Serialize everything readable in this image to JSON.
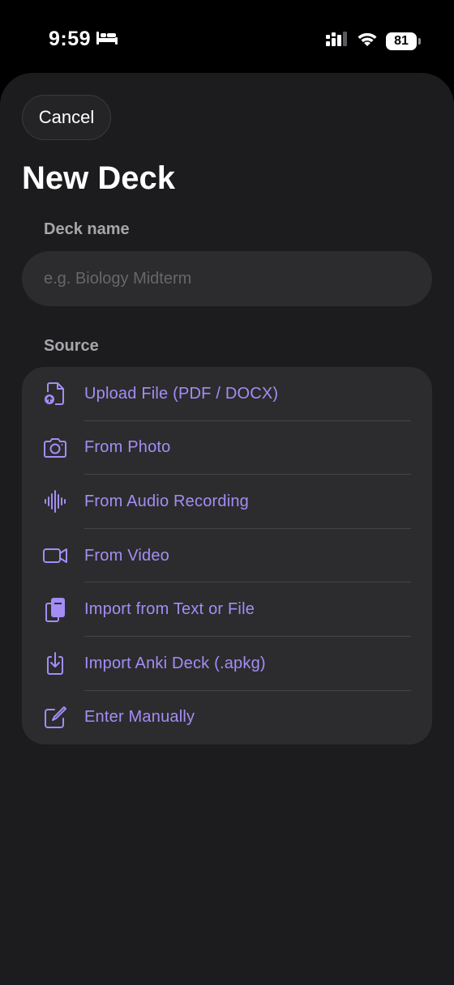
{
  "status_bar": {
    "time": "9:59",
    "battery": "81"
  },
  "sheet": {
    "cancel_label": "Cancel",
    "title": "New Deck"
  },
  "deck_name": {
    "label": "Deck name",
    "placeholder": "e.g. Biology Midterm",
    "value": ""
  },
  "source": {
    "label": "Source",
    "items": [
      {
        "label": "Upload File (PDF / DOCX)",
        "icon": "upload-file-icon"
      },
      {
        "label": "From Photo",
        "icon": "camera-icon"
      },
      {
        "label": "From Audio Recording",
        "icon": "waveform-icon"
      },
      {
        "label": "From Video",
        "icon": "video-camera-icon"
      },
      {
        "label": "Import from Text or File",
        "icon": "documents-icon"
      },
      {
        "label": "Import Anki Deck (.apkg)",
        "icon": "download-tray-icon"
      },
      {
        "label": "Enter Manually",
        "icon": "compose-icon"
      }
    ]
  },
  "colors": {
    "accent": "#a48df5",
    "sheet_background": "#1c1c1e",
    "field_background": "#2c2c2e"
  }
}
